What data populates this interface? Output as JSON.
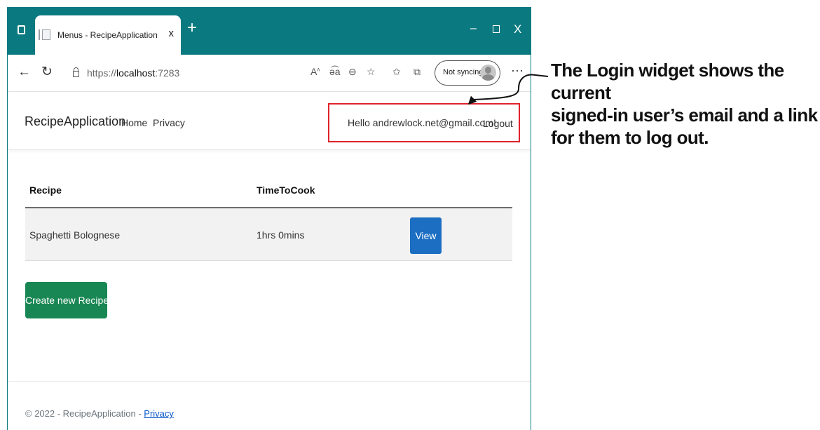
{
  "browser": {
    "tab_title": "Menus - RecipeApplication",
    "tab_close": "x",
    "new_tab": "+",
    "window_min": "–",
    "window_close": "X",
    "url_scheme": "https://",
    "url_host": "localhost",
    "url_port": ":7283",
    "sync_label": "Not syncing",
    "more": "···"
  },
  "navbar": {
    "brand": "RecipeApplication",
    "links": [
      "Home",
      "Privacy"
    ],
    "hello": "Hello andrewlock.net@gmail.com!",
    "logout": "Logout"
  },
  "table": {
    "headers": [
      "Recipe",
      "TimeToCook"
    ],
    "rows": [
      {
        "recipe": "Spaghetti Bolognese",
        "time": "1hrs 0mins",
        "action": "View"
      }
    ]
  },
  "create_button": "Create new Recipe",
  "footer": {
    "text": "© 2022 - RecipeApplication - ",
    "link": "Privacy"
  },
  "annotation": {
    "lines": [
      "The Login widget shows the current",
      "signed-in user’s email and a link",
      "for them to log out."
    ]
  },
  "colors": {
    "titlebar": "#0b7a80",
    "highlight": "#e0232c",
    "view_button": "#1b6ec2",
    "create_button": "#198754"
  }
}
